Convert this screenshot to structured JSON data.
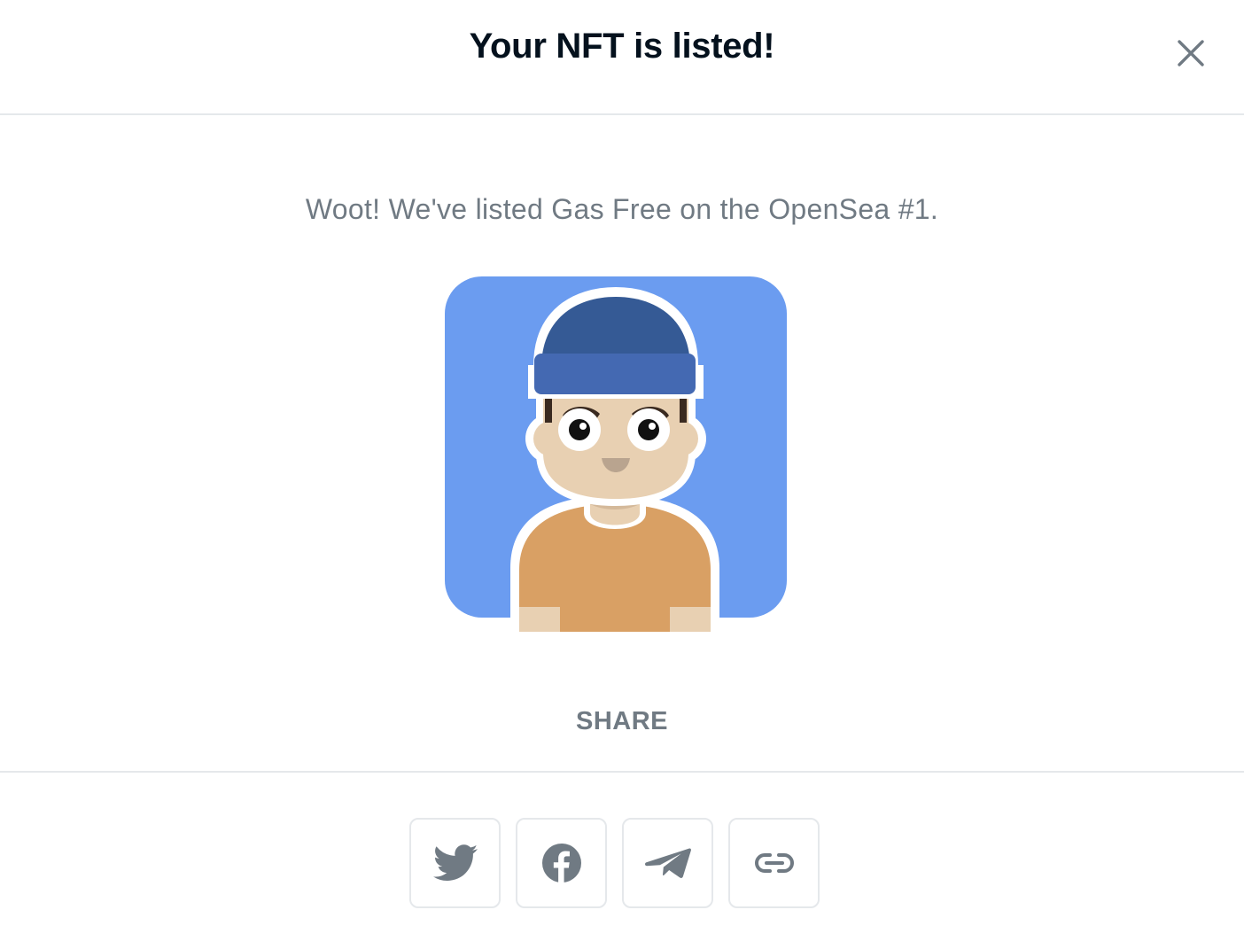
{
  "header": {
    "title": "Your NFT is listed!",
    "close_icon": "close-icon"
  },
  "body": {
    "message": "Woot! We've listed Gas Free on the OpenSea #1.",
    "nft_image": "avatar-beanie-boy"
  },
  "share": {
    "label": "SHARE",
    "buttons": [
      {
        "name": "twitter",
        "icon": "twitter-icon"
      },
      {
        "name": "facebook",
        "icon": "facebook-icon"
      },
      {
        "name": "telegram",
        "icon": "telegram-icon"
      },
      {
        "name": "copy-link",
        "icon": "link-icon"
      }
    ]
  },
  "colors": {
    "title": "#04111d",
    "muted_text": "#707a83",
    "border": "#e5e8eb",
    "icon": "#707a83",
    "nft_background": "#6b9cf0",
    "beanie_top": "#355a95",
    "beanie_band": "#4469b2",
    "skin": "#e8d0b2",
    "shirt": "#d9a064"
  }
}
